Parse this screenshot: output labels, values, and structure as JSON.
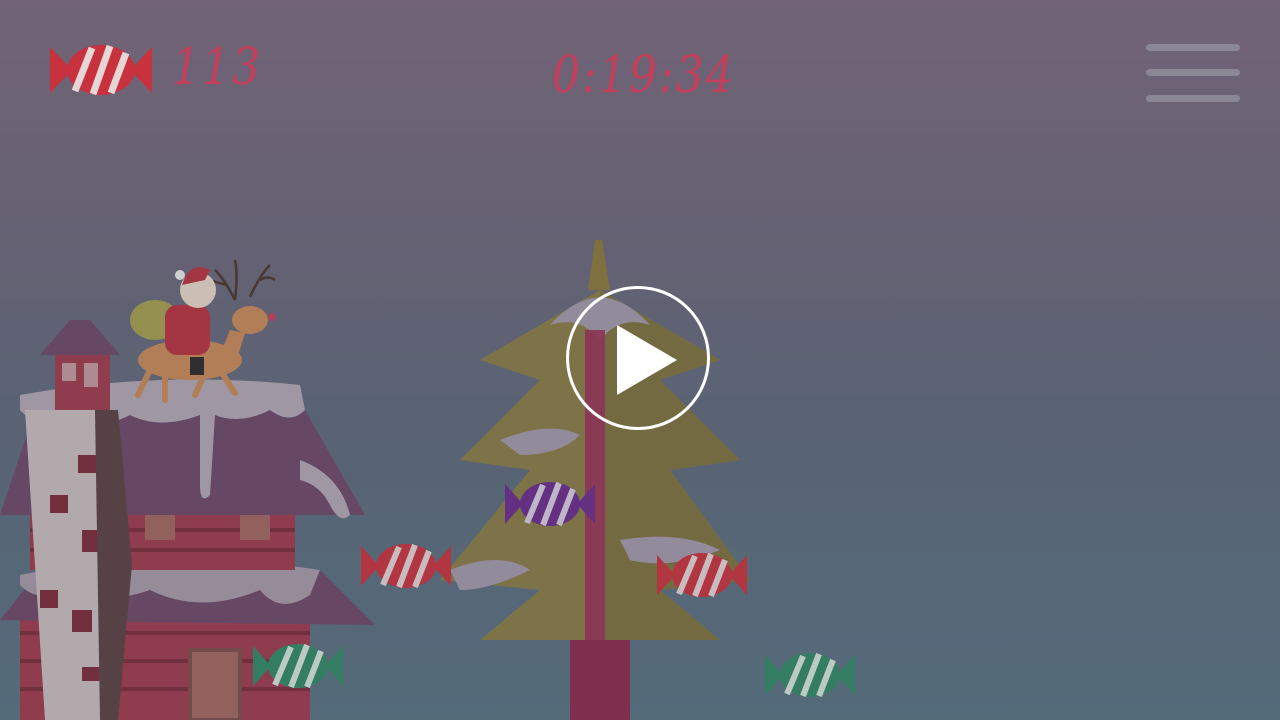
{
  "hud": {
    "candy_icon": "striped-candy-icon",
    "candy_count": "113",
    "timer": "0:19:34",
    "menu_icon": "hamburger-menu-icon"
  },
  "overlay": {
    "state": "paused",
    "play_icon": "play-icon"
  },
  "scene": {
    "player": "santa-on-reindeer",
    "candies": [
      {
        "color": "red"
      },
      {
        "color": "purple"
      },
      {
        "color": "red"
      },
      {
        "color": "green"
      },
      {
        "color": "green"
      }
    ]
  },
  "colors": {
    "hud_text": "#c43f5c",
    "candy_red": "#c8323e",
    "candy_purple": "#6b2d8c",
    "candy_green": "#2f8a66",
    "play_button": "#ffffff"
  }
}
